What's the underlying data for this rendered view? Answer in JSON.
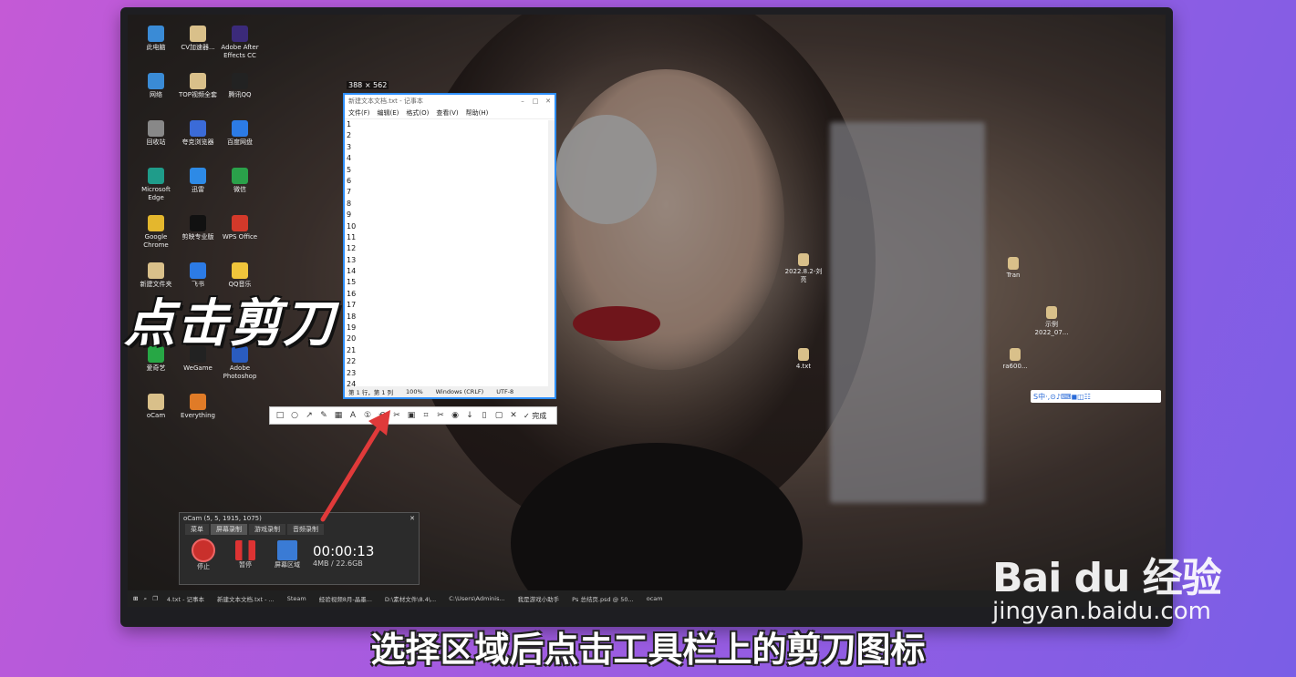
{
  "caption": "点击剪刀",
  "subtitle": "选择区域后点击工具栏上的剪刀图标",
  "watermark": {
    "brand": "Bai du 经验",
    "url": "jingyan.baidu.com"
  },
  "desktop_icons": [
    {
      "label": "此电脑",
      "color": "#3a8bd6"
    },
    {
      "label": "CV加速器...",
      "color": "#d9c08a"
    },
    {
      "label": "Adobe After Effects CC",
      "color": "#3b2a7a"
    },
    {
      "label": "网络",
      "color": "#3a8bd6"
    },
    {
      "label": "TOP视频全套",
      "color": "#d9c08a"
    },
    {
      "label": "腾讯QQ",
      "color": "#222"
    },
    {
      "label": "回收站",
      "color": "#888"
    },
    {
      "label": "夸克浏览器",
      "color": "#3b6bd8"
    },
    {
      "label": "百度网盘",
      "color": "#2c7be5"
    },
    {
      "label": "Microsoft Edge",
      "color": "#1f9c8a"
    },
    {
      "label": "迅雷",
      "color": "#2d8ae6"
    },
    {
      "label": "微信",
      "color": "#2aa14a"
    },
    {
      "label": "Google Chrome",
      "color": "#e4b72d"
    },
    {
      "label": "剪映专业版",
      "color": "#111"
    },
    {
      "label": "WPS Office",
      "color": "#d3392a"
    },
    {
      "label": "新建文件夹",
      "color": "#d9c08a"
    },
    {
      "label": "飞书",
      "color": "#2c7be5"
    },
    {
      "label": "QQ音乐",
      "color": "#f0c53b"
    },
    {
      "label": "爱奇艺",
      "color": "#27a745"
    },
    {
      "label": "WeGame",
      "color": "#222"
    },
    {
      "label": "Adobe Photoshop",
      "color": "#2a5cbf"
    },
    {
      "label": "oCam",
      "color": "#d9c08a"
    },
    {
      "label": "Everything",
      "color": "#e07b27"
    }
  ],
  "selection": {
    "size_label": "388 × 562"
  },
  "notepad": {
    "title": "新建文本文档.txt - 记事本",
    "menu": [
      "文件(F)",
      "编辑(E)",
      "格式(O)",
      "查看(V)",
      "帮助(H)"
    ],
    "lines": [
      "1",
      "2",
      "3",
      "4",
      "5",
      "6",
      "7",
      "8",
      "9",
      "10",
      "11",
      "12",
      "13",
      "14",
      "15",
      "16",
      "17",
      "18",
      "19",
      "20",
      "21",
      "22",
      "23",
      "24"
    ],
    "status": [
      "第 1 行，第 1 列",
      "100%",
      "Windows (CRLF)",
      "UTF-8"
    ]
  },
  "toolbar": {
    "tools": [
      "□",
      "○",
      "↗",
      "✎",
      "▦",
      "A",
      "①",
      "↶",
      "✂",
      "▣",
      "⌗",
      "✂",
      "◉",
      "↓",
      "▯",
      "▢",
      "✕"
    ],
    "done_label": "✓ 完成"
  },
  "ocam": {
    "title": "oCam (5, 5, 1915, 1075)",
    "tabs": [
      "菜单",
      "屏幕录制",
      "游戏录制",
      "音频录制"
    ],
    "stop_label": "停止",
    "pause_label": "暂停",
    "area_label": "屏幕区域",
    "time": "00:00:13",
    "size": "4MB / 22.6GB"
  },
  "taskbar": {
    "items": [
      "4.txt - 记事本",
      "新建文本文档.txt - ...",
      "Steam",
      "经验视频8月-晶墨...",
      "D:\\素材文件\\8.4\\...",
      "C:\\Users\\Adminis...",
      "我是游戏小助手",
      "Ps 总结页.psd @ 50...",
      "ocam"
    ]
  },
  "ime": {
    "label": "S中·,⊙♪⌨◼◫☷"
  },
  "files_right": [
    {
      "label": "2022.8.2-刘亮"
    },
    {
      "label": "4.txt"
    },
    {
      "label": "Tran"
    },
    {
      "label": "示例 2022_07..."
    },
    {
      "label": "ra600..."
    }
  ]
}
